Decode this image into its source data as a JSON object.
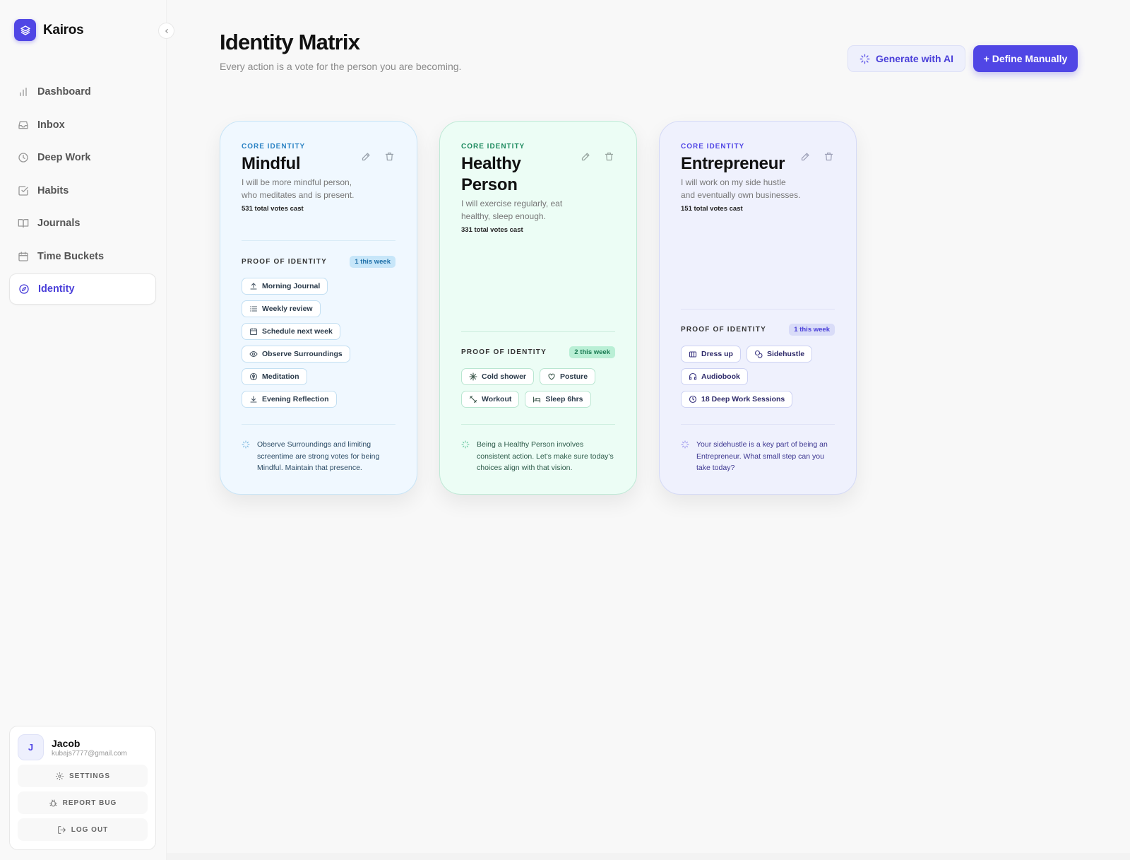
{
  "app": {
    "name": "Kairos"
  },
  "sidebar": {
    "items": [
      {
        "label": "Dashboard",
        "icon": "bar-chart-icon",
        "active": false
      },
      {
        "label": "Inbox",
        "icon": "inbox-icon",
        "active": false
      },
      {
        "label": "Deep Work",
        "icon": "clock-icon",
        "active": false
      },
      {
        "label": "Habits",
        "icon": "check-square-icon",
        "active": false
      },
      {
        "label": "Journals",
        "icon": "book-open-icon",
        "active": false
      },
      {
        "label": "Time Buckets",
        "icon": "calendar-icon",
        "active": false
      },
      {
        "label": "Identity",
        "icon": "compass-icon",
        "active": true
      }
    ]
  },
  "user": {
    "initial": "J",
    "name": "Jacob",
    "email": "kubajs7777@gmail.com",
    "settings_label": "SETTINGS",
    "report_bug_label": "REPORT BUG",
    "logout_label": "LOG OUT"
  },
  "header": {
    "title": "Identity Matrix",
    "subtitle": "Every action is a vote for the person you are becoming.",
    "generate_label": "Generate with AI",
    "define_label": "+ Define Manually"
  },
  "cards": [
    {
      "eyebrow": "CORE IDENTITY",
      "title": "Mindful",
      "description": "I will be more mindful person, who meditates and is present.",
      "votes": "531 total votes cast",
      "proof_label": "PROOF OF IDENTITY",
      "week_badge": "1 this week",
      "habits": [
        {
          "label": "Morning Journal",
          "icon": "upload-icon"
        },
        {
          "label": "Weekly review",
          "icon": "list-icon"
        },
        {
          "label": "Schedule next week",
          "icon": "calendar-icon"
        },
        {
          "label": "Observe Surroundings",
          "icon": "eye-icon"
        },
        {
          "label": "Meditation",
          "icon": "lotus-icon"
        },
        {
          "label": "Evening Reflection",
          "icon": "download-icon"
        }
      ],
      "insight": "Observe Surroundings and limiting screentime are strong votes for being Mindful. Maintain that presence."
    },
    {
      "eyebrow": "CORE IDENTITY",
      "title": "Healthy Person",
      "description": "I will exercise regularly, eat healthy, sleep enough.",
      "votes": "331 total votes cast",
      "proof_label": "PROOF OF IDENTITY",
      "week_badge": "2 this week",
      "habits": [
        {
          "label": "Cold shower",
          "icon": "snowflake-icon"
        },
        {
          "label": "Posture",
          "icon": "heart-icon"
        },
        {
          "label": "Workout",
          "icon": "dumbbell-icon"
        },
        {
          "label": "Sleep 6hrs",
          "icon": "bed-icon"
        }
      ],
      "insight": "Being a Healthy Person involves consistent action. Let's make sure today's choices align with that vision."
    },
    {
      "eyebrow": "CORE IDENTITY",
      "title": "Entrepreneur",
      "description": "I will work on my side hustle and eventually own businesses.",
      "votes": "151 total votes cast",
      "proof_label": "PROOF OF IDENTITY",
      "week_badge": "1 this week",
      "habits": [
        {
          "label": "Dress up",
          "icon": "shirt-icon"
        },
        {
          "label": "Sidehustle",
          "icon": "coins-icon"
        },
        {
          "label": "Audiobook",
          "icon": "headphones-icon"
        },
        {
          "label": "18 Deep Work Sessions",
          "icon": "clock-icon"
        }
      ],
      "insight": "Your sidehustle is a key part of being an Entrepreneur. What small step can you take today?"
    }
  ],
  "colors": {
    "accent": "#5046e5",
    "mindful": "#f0f8ff",
    "healthy": "#ecfdf5",
    "entrepreneur": "#eff1fd"
  }
}
